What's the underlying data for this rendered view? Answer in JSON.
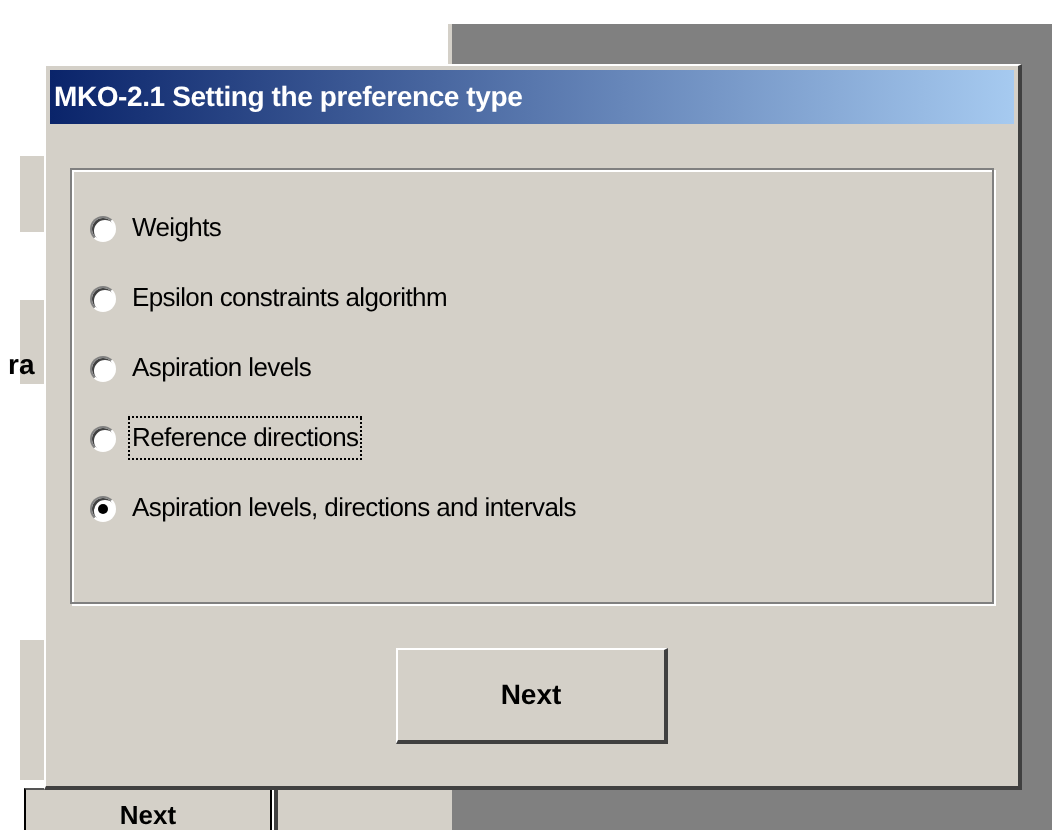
{
  "background_window": {
    "partial_text": "ra",
    "button": "Next"
  },
  "dialog": {
    "title": "MKO-2.1 Setting the preference type",
    "options": [
      {
        "label": "Weights",
        "selected": false,
        "focused": false
      },
      {
        "label": "Epsilon constraints algorithm",
        "selected": false,
        "focused": false
      },
      {
        "label": "Aspiration levels",
        "selected": false,
        "focused": false
      },
      {
        "label": "Reference directions",
        "selected": false,
        "focused": true
      },
      {
        "label": "Aspiration levels, directions and intervals",
        "selected": true,
        "focused": false
      }
    ],
    "button": "Next"
  }
}
